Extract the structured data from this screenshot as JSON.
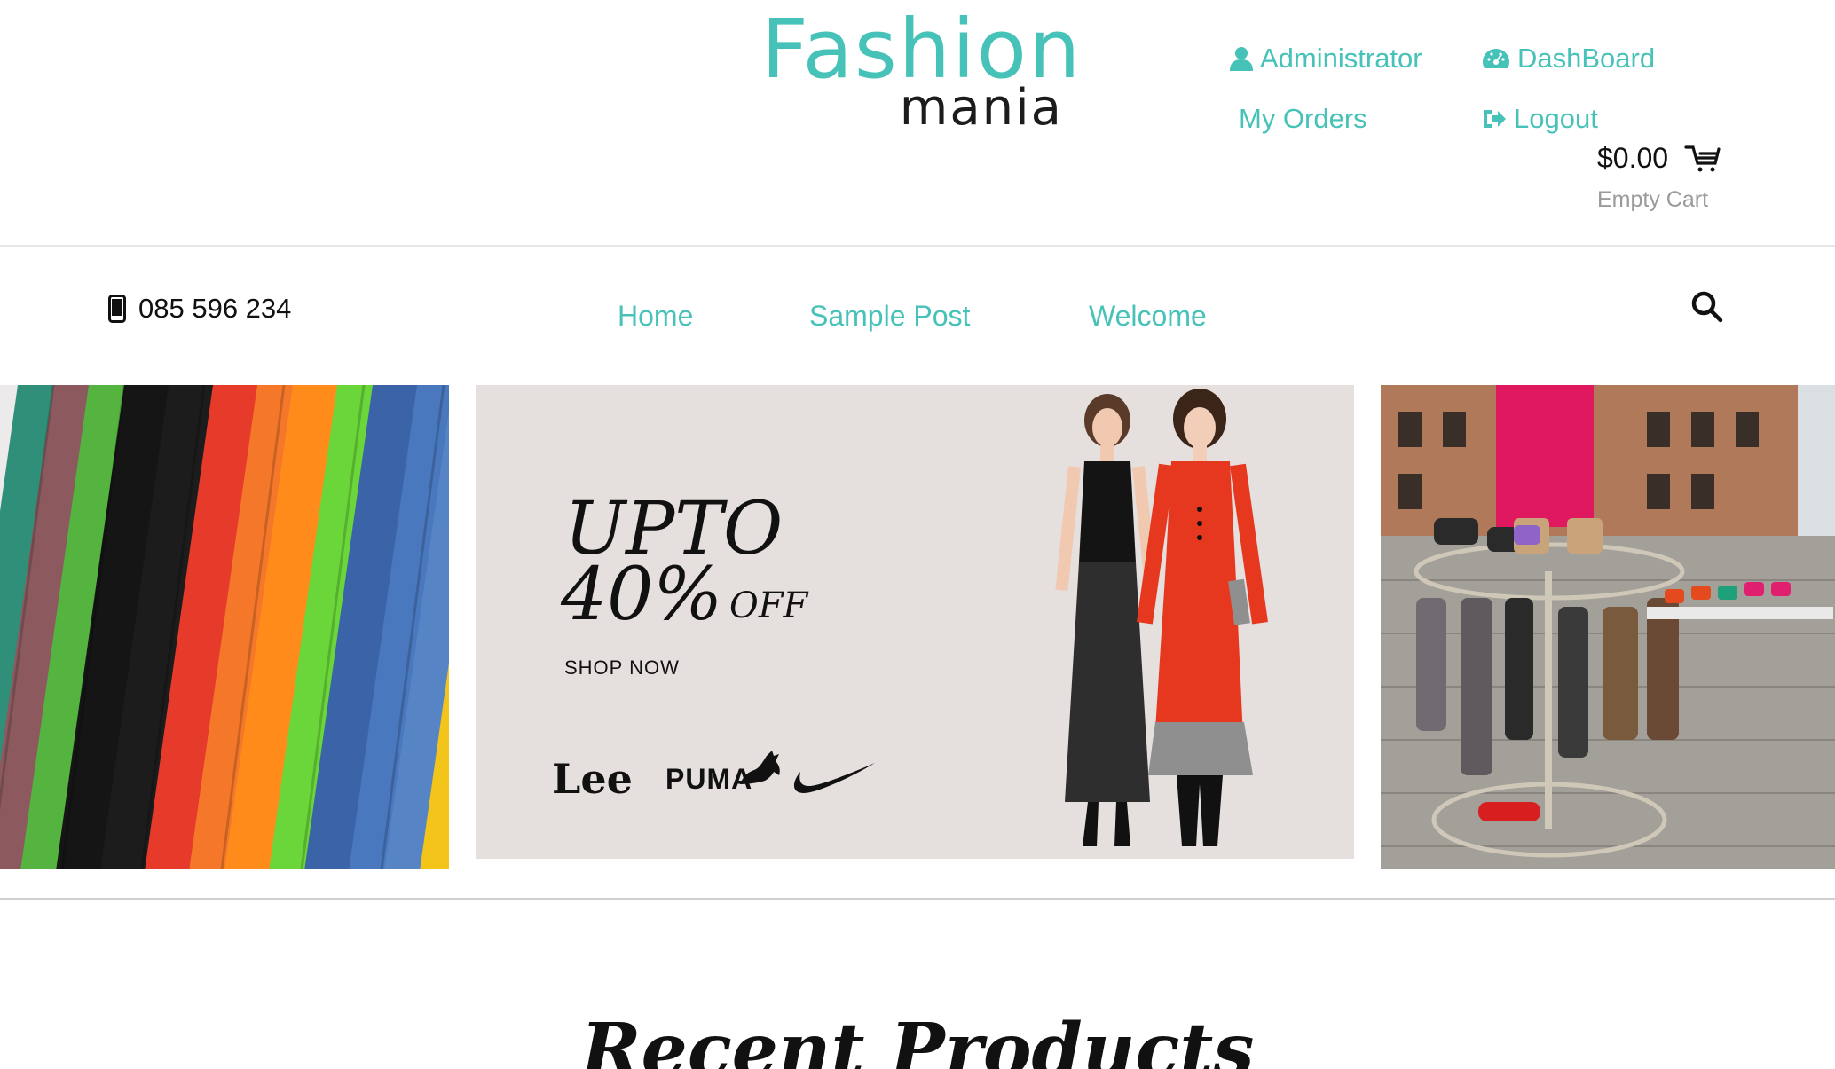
{
  "brand": {
    "logo_top": "Fashion",
    "logo_bottom": "mania",
    "accent_color": "#47c2b9"
  },
  "account_menu": {
    "administrator": "Administrator",
    "dashboard": "DashBoard",
    "my_orders": "My Orders",
    "logout": "Logout"
  },
  "cart": {
    "total": "$0.00",
    "state": "Empty Cart"
  },
  "contact": {
    "phone": "085 596 234"
  },
  "nav": {
    "items": [
      "Home",
      "Sample Post",
      "Welcome"
    ]
  },
  "banner": {
    "promo_line1": "UPTO",
    "promo_line2": "40%",
    "promo_off": "OFF",
    "shop_now": "SHOP NOW",
    "brands": [
      "Lee",
      "PUMA"
    ]
  },
  "section": {
    "title": "Recent Products"
  },
  "icons": [
    "user-icon",
    "dashboard-icon",
    "logout-icon",
    "cart-icon",
    "phone-icon",
    "search-icon",
    "nike-swoosh-icon",
    "puma-cat-icon"
  ]
}
